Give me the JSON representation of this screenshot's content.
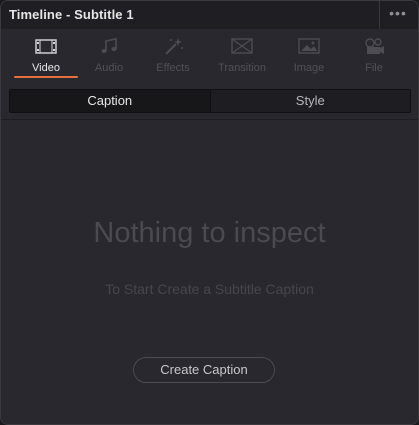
{
  "window": {
    "title": "Timeline - Subtitle 1",
    "more_icon": "more-horizontal-icon"
  },
  "tabs": [
    {
      "label": "Video",
      "icon": "film-icon",
      "active": true
    },
    {
      "label": "Audio",
      "icon": "music-note-icon",
      "active": false
    },
    {
      "label": "Effects",
      "icon": "magic-wand-icon",
      "active": false
    },
    {
      "label": "Transition",
      "icon": "transition-icon",
      "active": false
    },
    {
      "label": "Image",
      "icon": "image-icon",
      "active": false
    },
    {
      "label": "File",
      "icon": "film-reel-icon",
      "active": false
    }
  ],
  "subtabs": [
    {
      "label": "Caption",
      "active": true
    },
    {
      "label": "Style",
      "active": false
    }
  ],
  "empty_state": {
    "title": "Nothing to inspect",
    "subtitle": "To Start Create a Subtitle Caption",
    "button_label": "Create Caption"
  },
  "colors": {
    "accent": "#e4703e",
    "panel_bg": "#28282e",
    "titlebar_bg": "#1f1f23"
  }
}
